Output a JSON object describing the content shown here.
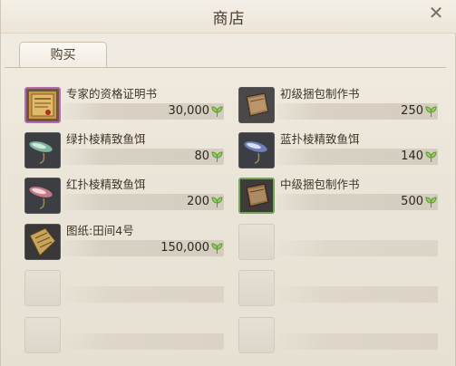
{
  "window": {
    "title": "商店"
  },
  "tabs": [
    {
      "label": "购买"
    }
  ],
  "items": [
    {
      "name": "专家的资格证明书",
      "price": "30,000",
      "icon": "certificate-icon"
    },
    {
      "name": "初级捆包制作书",
      "price": "250",
      "icon": "book-icon"
    },
    {
      "name": "绿扑棱精致鱼饵",
      "price": "80",
      "icon": "green-lure-icon"
    },
    {
      "name": "蓝扑棱精致鱼饵",
      "price": "140",
      "icon": "blue-lure-icon"
    },
    {
      "name": "红扑棱精致鱼饵",
      "price": "200",
      "icon": "red-lure-icon"
    },
    {
      "name": "中级捆包制作书",
      "price": "500",
      "icon": "book-icon"
    },
    {
      "name": "图纸:田间4号",
      "price": "150,000",
      "icon": "blueprint-icon"
    }
  ],
  "currency_icon": "leaf-icon",
  "colors": {
    "currency": "#7cc04a",
    "rare_border": "#b56ab8",
    "uncommon_border": "#74a35a"
  }
}
